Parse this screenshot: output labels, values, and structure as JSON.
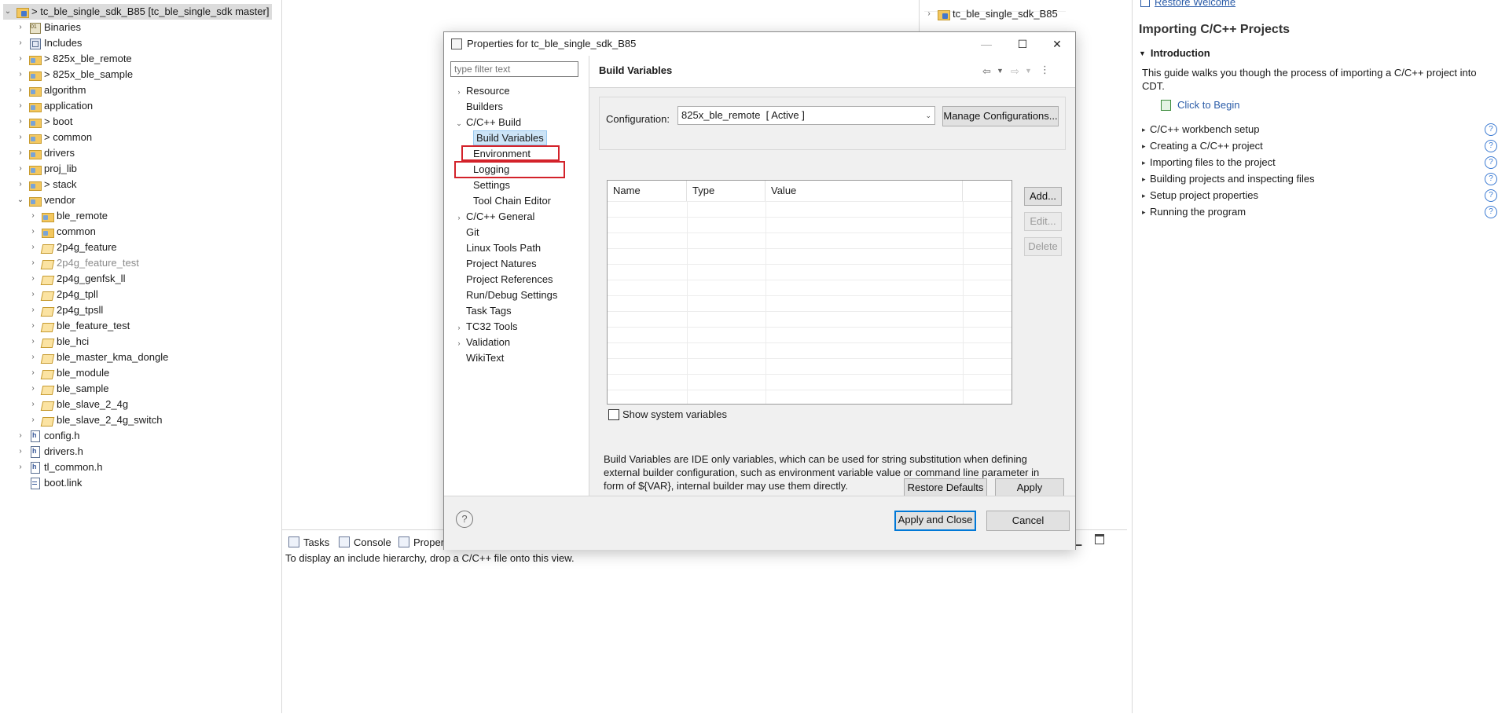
{
  "explorer": {
    "items": [
      {
        "label": "> tc_ble_single_sdk_B85 [tc_ble_single_sdk master]",
        "icon": "project-icon"
      },
      {
        "label": "Binaries",
        "icon": "binaries-icon"
      },
      {
        "label": "Includes",
        "icon": "includes-icon"
      },
      {
        "label": "> 825x_ble_remote",
        "icon": "source-folder-icon"
      },
      {
        "label": "> 825x_ble_sample",
        "icon": "source-folder-icon"
      },
      {
        "label": "algorithm",
        "icon": "source-folder-icon"
      },
      {
        "label": "application",
        "icon": "source-folder-icon"
      },
      {
        "label": "> boot",
        "icon": "source-folder-icon"
      },
      {
        "label": "> common",
        "icon": "source-folder-icon"
      },
      {
        "label": "drivers",
        "icon": "source-folder-icon"
      },
      {
        "label": "proj_lib",
        "icon": "source-folder-icon"
      },
      {
        "label": "> stack",
        "icon": "source-folder-icon"
      },
      {
        "label": "vendor",
        "icon": "source-folder-icon"
      },
      {
        "label": "ble_remote",
        "icon": "source-folder-icon"
      },
      {
        "label": "common",
        "icon": "source-folder-icon"
      },
      {
        "label": "2p4g_feature",
        "icon": "open-folder-icon"
      },
      {
        "label": "2p4g_feature_test",
        "icon": "open-folder-icon"
      },
      {
        "label": "2p4g_genfsk_ll",
        "icon": "open-folder-icon"
      },
      {
        "label": "2p4g_tpll",
        "icon": "open-folder-icon"
      },
      {
        "label": "2p4g_tpsll",
        "icon": "open-folder-icon"
      },
      {
        "label": "ble_feature_test",
        "icon": "open-folder-icon"
      },
      {
        "label": "ble_hci",
        "icon": "open-folder-icon"
      },
      {
        "label": "ble_master_kma_dongle",
        "icon": "open-folder-icon"
      },
      {
        "label": "ble_module",
        "icon": "open-folder-icon"
      },
      {
        "label": "ble_sample",
        "icon": "open-folder-icon"
      },
      {
        "label": "ble_slave_2_4g",
        "icon": "open-folder-icon"
      },
      {
        "label": "ble_slave_2_4g_switch",
        "icon": "open-folder-icon"
      },
      {
        "label": "config.h",
        "icon": "header-file-icon"
      },
      {
        "label": "drivers.h",
        "icon": "header-file-icon"
      },
      {
        "label": "tl_common.h",
        "icon": "header-file-icon"
      },
      {
        "label": "boot.link",
        "icon": "link-file-icon"
      }
    ]
  },
  "outline": {
    "item": "tc_ble_single_sdk_B85"
  },
  "bottom_panel": {
    "tabs": [
      "Tasks",
      "Console",
      "Proper"
    ],
    "message": "To display an include hierarchy, drop a C/C++ file onto this view."
  },
  "welcome": {
    "restore_link": "Restore Welcome",
    "title": "Importing C/C++ Projects",
    "intro_heading": "Introduction",
    "intro_text": "This guide walks you though the process of importing a C/C++ project into CDT.",
    "click_to_begin": "Click to Begin",
    "steps": [
      "C/C++ workbench setup",
      "Creating a C/C++ project",
      "Importing files to the project",
      "Building projects and inspecting files",
      "Setup project properties",
      "Running the program"
    ]
  },
  "dialog": {
    "title": "Properties for tc_ble_single_sdk_B85",
    "filter_placeholder": "type filter text",
    "nav": [
      {
        "label": "Resource",
        "level": 0,
        "chev": "›"
      },
      {
        "label": "Builders",
        "level": 0,
        "chev": ""
      },
      {
        "label": "C/C++ Build",
        "level": 0,
        "chev": "⌄"
      },
      {
        "label": "Build Variables",
        "level": 1,
        "chev": ""
      },
      {
        "label": "Environment",
        "level": 1,
        "chev": ""
      },
      {
        "label": "Logging",
        "level": 1,
        "chev": ""
      },
      {
        "label": "Settings",
        "level": 1,
        "chev": ""
      },
      {
        "label": "Tool Chain Editor",
        "level": 1,
        "chev": ""
      },
      {
        "label": "C/C++ General",
        "level": 0,
        "chev": "›"
      },
      {
        "label": "Git",
        "level": 0,
        "chev": ""
      },
      {
        "label": "Linux Tools Path",
        "level": 0,
        "chev": ""
      },
      {
        "label": "Project Natures",
        "level": 0,
        "chev": ""
      },
      {
        "label": "Project References",
        "level": 0,
        "chev": ""
      },
      {
        "label": "Run/Debug Settings",
        "level": 0,
        "chev": ""
      },
      {
        "label": "Task Tags",
        "level": 0,
        "chev": ""
      },
      {
        "label": "TC32 Tools",
        "level": 0,
        "chev": "›"
      },
      {
        "label": "Validation",
        "level": 0,
        "chev": "›"
      },
      {
        "label": "WikiText",
        "level": 0,
        "chev": ""
      }
    ],
    "page_title": "Build Variables",
    "configuration_label": "Configuration:",
    "configuration_value": "825x_ble_remote  [ Active ]",
    "manage_configurations": "Manage Configurations...",
    "table_headers": [
      "Name",
      "Type",
      "Value"
    ],
    "add_button": "Add...",
    "edit_button": "Edit...",
    "delete_button": "Delete",
    "show_system_variables": "Show system variables",
    "description": "Build Variables are IDE only variables, which can be used for string substitution when defining external builder configuration, such as environment variable value or command line parameter in form of ${VAR}, internal builder may use them directly.",
    "restore_defaults": "Restore Defaults",
    "apply": "Apply",
    "apply_and_close": "Apply and Close",
    "cancel": "Cancel"
  },
  "colors": {
    "highlight_box": "#d3222a",
    "selection": "#cce4f7",
    "link": "#2b5ca8"
  }
}
